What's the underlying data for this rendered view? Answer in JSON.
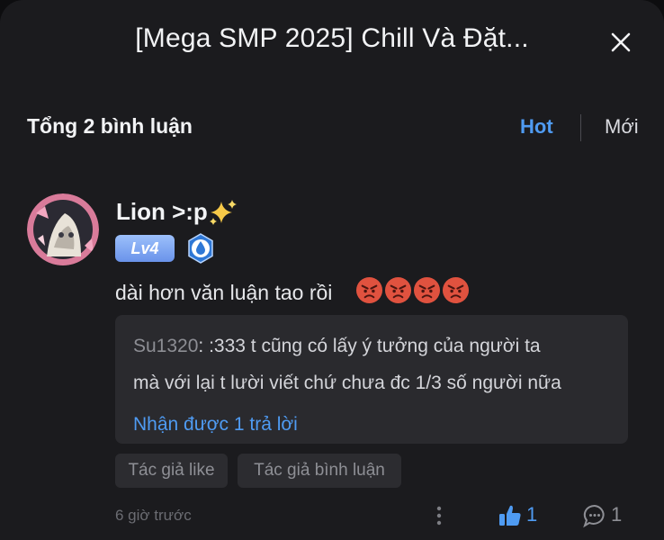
{
  "header": {
    "title": "[Mega SMP 2025] Chill Và Đặt...",
    "close_icon": "close-icon"
  },
  "comments_bar": {
    "total_label": "Tổng 2 bình luận",
    "sort_hot": "Hot",
    "sort_new": "Mới",
    "active_sort": "Hot",
    "accent_color": "#4f9bf2"
  },
  "comment": {
    "username": "Lion >:p",
    "level_badge": "Lv4",
    "badge_icon": "water-drop-badge-icon",
    "text": "dài hơn văn luận tao rồi",
    "emojis": [
      "angry-face-icon",
      "angry-face-icon",
      "angry-face-icon",
      "angry-face-icon"
    ],
    "reply_preview": {
      "author": "Su1320",
      "separator": ":",
      "line1": " :333 t cũng có lấy ý tưởng của người ta",
      "line2": "mà với lại t lười viết chứ chưa đc 1/3 số người nữa",
      "more_replies": "Nhận được 1 trả lời"
    },
    "tags": [
      "Tác giả like",
      "Tác giả bình luận"
    ],
    "time": "6 giờ trước",
    "likes": "1",
    "replies": "1"
  }
}
